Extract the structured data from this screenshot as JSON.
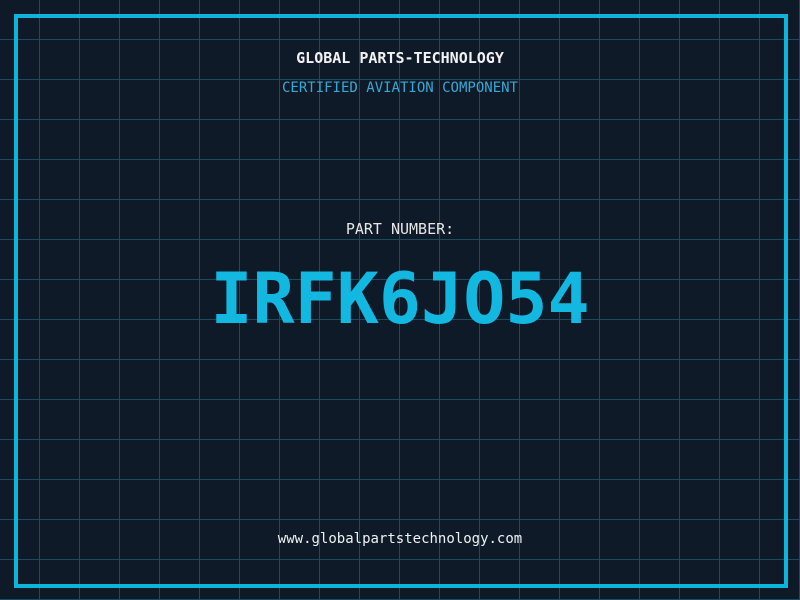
{
  "label": {
    "title": "GLOBAL PARTS-TECHNOLOGY",
    "subtitle": "CERTIFIED AVIATION COMPONENT",
    "part_label": "PART NUMBER:",
    "part_number": "IRFK6JO54",
    "website": "www.globalpartstechnology.com"
  },
  "colors": {
    "background": "#0f1a29",
    "grid": "#1d4a61",
    "frame": "#0db5d8",
    "part_number": "#12b8e0",
    "subtitle": "#35a9d6",
    "text": "#f2f2f2"
  }
}
